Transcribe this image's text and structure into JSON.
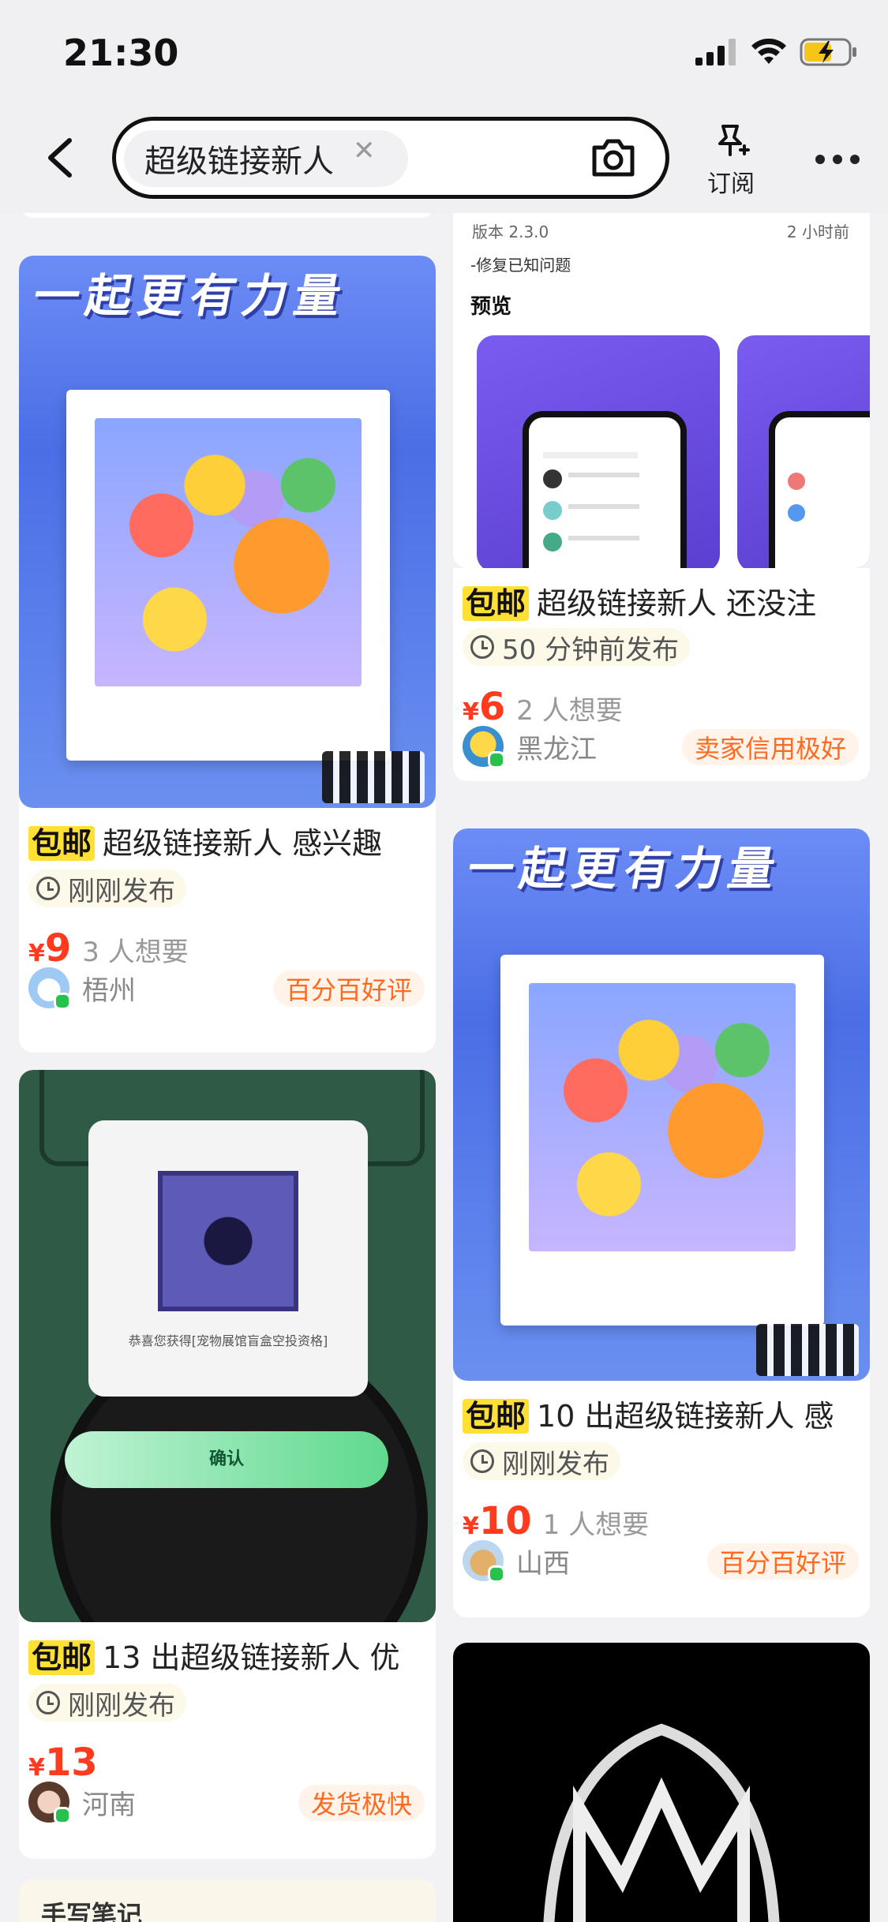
{
  "status_bar": {
    "time": "21:30"
  },
  "search": {
    "query": "超级链接新人"
  },
  "header": {
    "subscribe_label": "订阅"
  },
  "partial_top": {
    "version": "版本 2.3.0",
    "ago": "2 小时前",
    "note": "-修复已知问题",
    "preview": "预览"
  },
  "cards": [
    {
      "poster_text": "一起更有力量",
      "badge": "包邮",
      "title": "超级链接新人 感兴趣",
      "posted": "刚刚发布",
      "currency": "¥",
      "price": "9",
      "wants": "3 人想要",
      "location": "梧州",
      "tag": "百分百好评"
    },
    {
      "badge": "包邮",
      "title": "超级链接新人 还没注",
      "posted": "50 分钟前发布",
      "currency": "¥",
      "price": "6",
      "wants": "2 人想要",
      "location": "黑龙江",
      "tag": "卖家信用极好"
    },
    {
      "popup_text": "恭喜您获得[宠物展馆盲盒空投资格]",
      "button": "确认",
      "badge": "包邮",
      "title": "13 出超级链接新人 优",
      "posted": "刚刚发布",
      "currency": "¥",
      "price": "13",
      "location": "河南",
      "tag": "发货极快"
    },
    {
      "poster_text": "一起更有力量",
      "badge": "包邮",
      "title": "10 出超级链接新人 感",
      "posted": "刚刚发布",
      "currency": "¥",
      "price": "10",
      "wants": "1 人想要",
      "location": "山西",
      "tag": "百分百好评"
    }
  ],
  "partial_bottom": {
    "label": "手写笔记"
  }
}
